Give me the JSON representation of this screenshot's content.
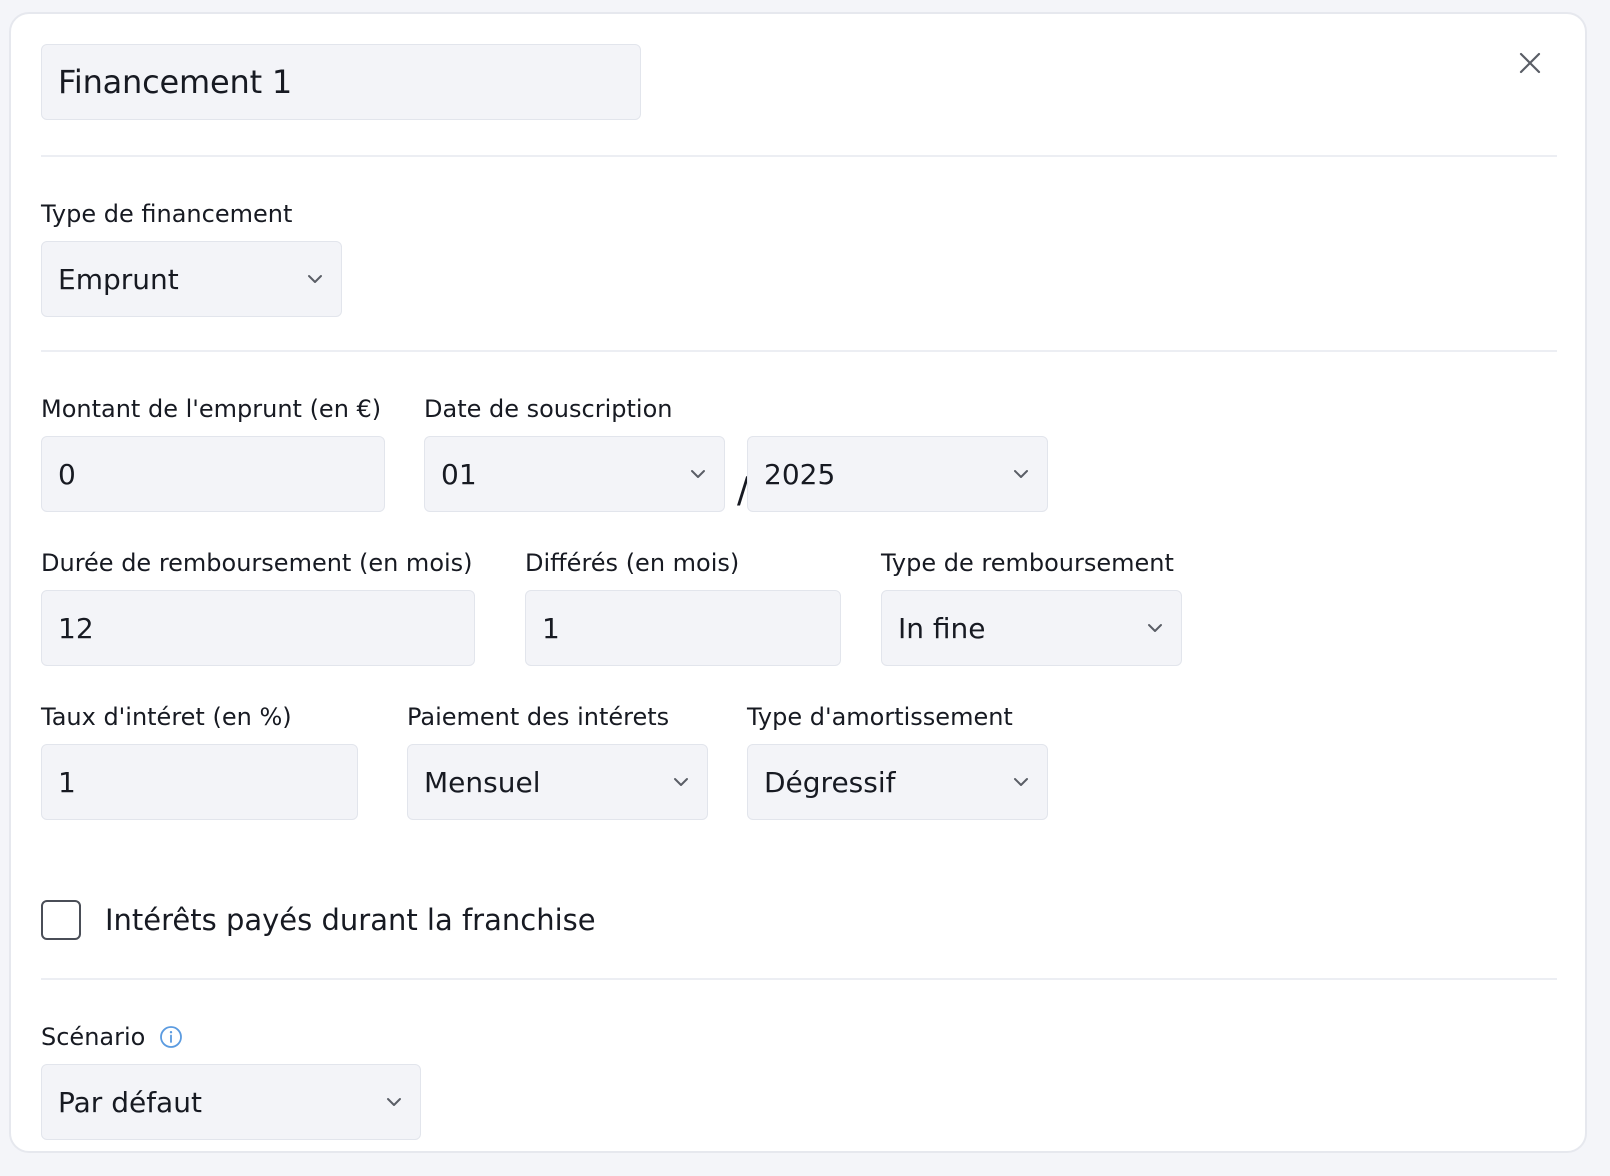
{
  "title": "Financement 1",
  "close_icon": "close-icon",
  "financing_type": {
    "label": "Type de financement",
    "value": "Emprunt"
  },
  "loan_amount": {
    "label": "Montant de l'emprunt (en €)",
    "value": "0"
  },
  "subscription_date": {
    "label": "Date de souscription",
    "month": "01",
    "year": "2025",
    "separator": "/"
  },
  "repayment_duration": {
    "label": "Durée de remboursement (en mois)",
    "value": "12"
  },
  "deferral": {
    "label": "Différés (en mois)",
    "value": "1"
  },
  "repayment_type": {
    "label": "Type de remboursement",
    "value": "In fine"
  },
  "interest_rate": {
    "label": "Taux d'intéret (en %)",
    "value": "1"
  },
  "interest_payment": {
    "label": "Paiement des intérets",
    "value": "Mensuel"
  },
  "amortization_type": {
    "label": "Type d'amortissement",
    "value": "Dégressif"
  },
  "interest_during_grace": {
    "label": "Intérêts payés durant la franchise",
    "checked": false
  },
  "scenario": {
    "label": "Scénario",
    "value": "Par défaut",
    "info_icon": "info-icon"
  },
  "colors": {
    "page_bg": "#f4f5f9",
    "card_bg": "#ffffff",
    "field_bg": "#f3f4f8",
    "text": "#171a22",
    "info_accent": "#5b9be0"
  }
}
